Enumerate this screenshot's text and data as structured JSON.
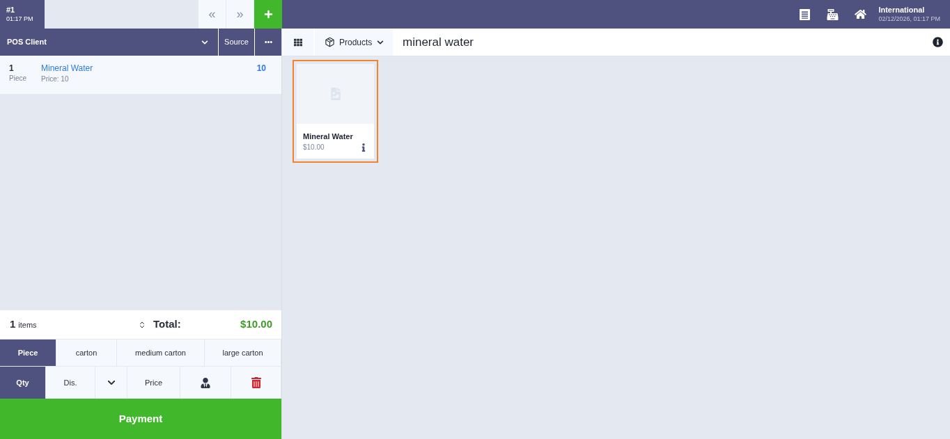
{
  "tickets": [
    {
      "number": "#1",
      "time": "01:17 PM",
      "selected": true
    }
  ],
  "nav_buttons": [
    {
      "label": "«",
      "disabled": true
    },
    {
      "label": "»",
      "disabled": true
    }
  ],
  "header": {
    "store": "International",
    "datetime": "02/12/2026, 01:17 PM"
  },
  "client_bar": {
    "client": "POS Client",
    "source_button": "Source"
  },
  "order_lines": [
    {
      "qty": "1",
      "unit": "Piece",
      "name": "Mineral Water",
      "price": "Price: 10",
      "total": "10"
    }
  ],
  "totals": {
    "count": "1",
    "count_label": "items",
    "label": "Total:",
    "amount": "$10.00"
  },
  "units": [
    {
      "label": "Piece",
      "selected": true
    },
    {
      "label": "carton",
      "selected": false
    },
    {
      "label": "medium carton",
      "selected": false
    },
    {
      "label": "large carton",
      "selected": false
    }
  ],
  "actions": [
    {
      "kind": "text",
      "label": "Qty",
      "selected": true
    },
    {
      "kind": "text",
      "label": "Dis.",
      "selected": false
    },
    {
      "kind": "dropdown",
      "selected": false
    },
    {
      "kind": "text",
      "label": "Price",
      "selected": false
    },
    {
      "kind": "customer",
      "selected": false
    },
    {
      "kind": "delete",
      "selected": false
    }
  ],
  "payment_button": "Payment",
  "toolbar": {
    "category": "Products",
    "search": "mineral water"
  },
  "products": [
    {
      "name": "Mineral Water",
      "price": "$10.00",
      "selected": true
    }
  ]
}
